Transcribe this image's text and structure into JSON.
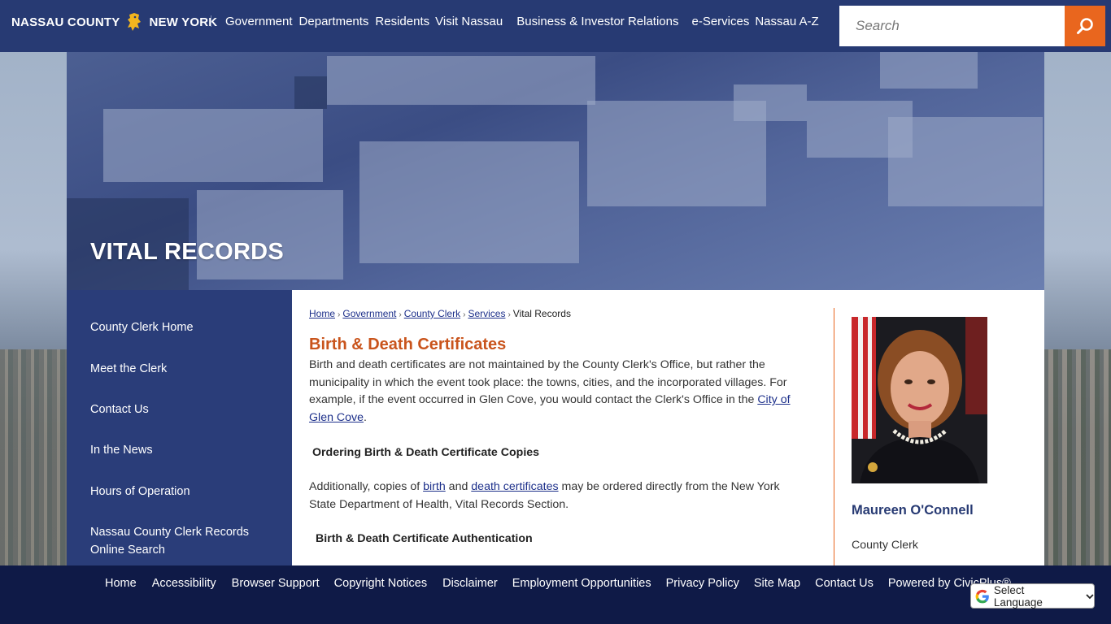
{
  "header": {
    "logo_left": "NASSAU COUNTY",
    "logo_right": "NEW YORK",
    "nav": [
      "Government",
      "Departments",
      "Residents",
      "Visit Nassau",
      "Business & Investor Relations",
      "e-Services",
      "Nassau A-Z"
    ],
    "search_placeholder": "Search"
  },
  "hero": {
    "title": "VITAL RECORDS"
  },
  "sidebar": {
    "items": [
      {
        "label": "County Clerk Home"
      },
      {
        "label": "Meet the Clerk"
      },
      {
        "label": "Contact Us"
      },
      {
        "label": "In the News"
      },
      {
        "label": "Hours of Operation"
      },
      {
        "label": "Nassau County Clerk Records Online Search"
      }
    ]
  },
  "breadcrumb": {
    "items": [
      "Home",
      "Government",
      "County Clerk",
      "Services"
    ],
    "current": "Vital Records"
  },
  "content": {
    "heading": "Birth & Death Certificates",
    "p1_text": " Birth and death certificates are not maintained by the County Clerk's Office, but rather the municipality in which the event took place: the towns, cities, and the incorporated villages. For example, if the event occurred in Glen Cove, you would contact the Clerk's Office in the ",
    "p1_link": "City of Glen Cove",
    "p1_end": ".",
    "sub1": "Ordering Birth & Death Certificate Copies",
    "p2_start": " Additionally, copies of ",
    "p2_link1": "birth",
    "p2_mid": " and ",
    "p2_link2": "death certificates",
    "p2_end": " may be ordered directly from the New York State Department of Health, Vital Records Section.",
    "sub2": "Birth & Death Certificate Authentication"
  },
  "clerk": {
    "name": "Maureen O'Connell",
    "title": "County Clerk"
  },
  "footer": {
    "links": [
      "Home",
      "Accessibility",
      "Browser Support",
      "Copyright Notices",
      "Disclaimer",
      "Employment Opportunities",
      "Privacy Policy",
      "Site Map",
      "Contact Us",
      "Powered by CivicPlus®"
    ],
    "language_label": "Select Language"
  },
  "colors": {
    "navy": "#273a73",
    "orange": "#e9661e",
    "heading": "#c9541c",
    "footer": "#0f1a47"
  }
}
